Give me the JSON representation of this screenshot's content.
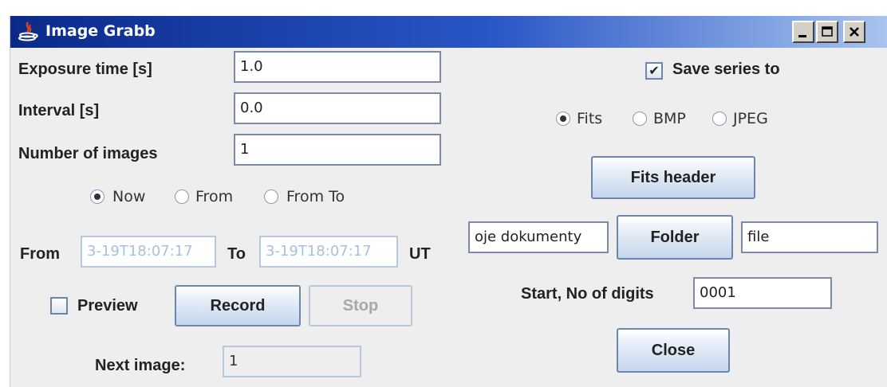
{
  "window": {
    "title": "Image Grabb",
    "minimize_icon": "minimize-icon",
    "maximize_icon": "maximize-icon",
    "close_icon": "close-icon"
  },
  "exposure": {
    "label": "Exposure time [s]",
    "value": "1.0"
  },
  "interval": {
    "label": "Interval [s]",
    "value": "0.0"
  },
  "num_images": {
    "label": "Number of images",
    "value": "1"
  },
  "start_mode": {
    "options": [
      "Now",
      "From",
      "From To"
    ],
    "selected": "Now"
  },
  "time_range": {
    "from_label": "From",
    "from_value": "3-19T18:07:17",
    "to_label": "To",
    "to_value": "3-19T18:07:17",
    "unit_label": "UT"
  },
  "preview": {
    "label": "Preview",
    "checked": false
  },
  "record_button": "Record",
  "stop_button": "Stop",
  "next_image": {
    "label": "Next image:",
    "value": "1"
  },
  "save_series": {
    "label": "Save series to",
    "checked": true,
    "check_glyph": "✔"
  },
  "format": {
    "options": [
      "Fits",
      "BMP",
      "JPEG"
    ],
    "selected": "Fits"
  },
  "fits_header_button": "Fits header",
  "folder": {
    "path": "oje dokumenty",
    "button": "Folder",
    "file": "file"
  },
  "start_digits": {
    "label": "Start, No of digits",
    "value": "0001"
  },
  "close_button": "Close"
}
